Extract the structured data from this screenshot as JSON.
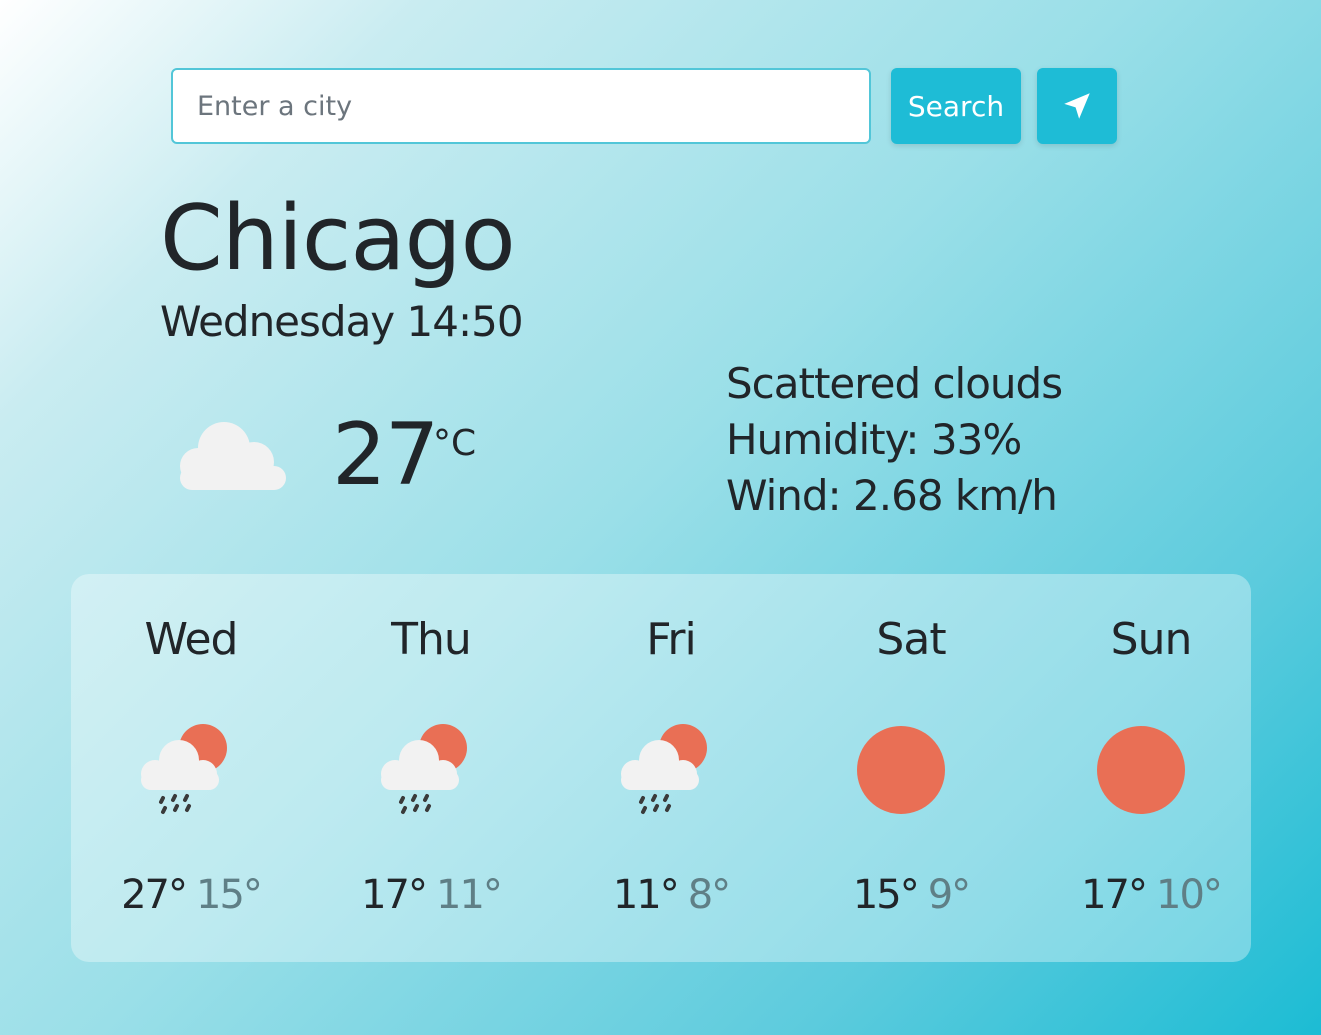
{
  "search": {
    "placeholder": "Enter a city",
    "button_label": "Search",
    "location_icon": "location-arrow-icon"
  },
  "current": {
    "city": "Chicago",
    "datetime": "Wednesday 14:50",
    "icon": "cloud-icon",
    "temperature": "27",
    "unit": "°C",
    "description": "Scattered clouds",
    "humidity": "Humidity: 33%",
    "wind": "Wind: 2.68 km/h"
  },
  "forecast": [
    {
      "day": "Wed",
      "icon": "rain-sun-cloud-icon",
      "max": "27°",
      "min": "15°"
    },
    {
      "day": "Thu",
      "icon": "rain-sun-cloud-icon",
      "max": "17°",
      "min": "11°"
    },
    {
      "day": "Fri",
      "icon": "rain-sun-cloud-icon",
      "max": "11°",
      "min": "8°"
    },
    {
      "day": "Sat",
      "icon": "sun-icon",
      "max": "15°",
      "min": "9°"
    },
    {
      "day": "Sun",
      "icon": "sun-icon",
      "max": "17°",
      "min": "10°"
    }
  ],
  "colors": {
    "accent": "#1ebcd6",
    "sun": "#e96f55",
    "cloud": "#f2f2f2",
    "min_temp": "#5f7f86"
  }
}
